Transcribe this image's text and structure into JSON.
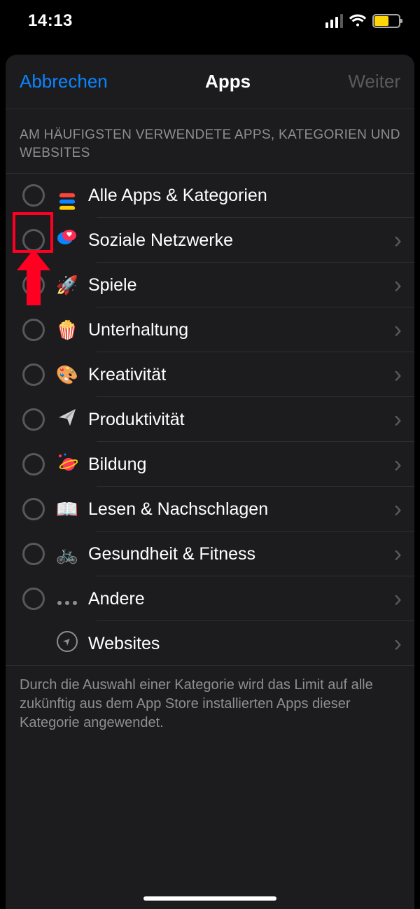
{
  "status": {
    "time": "14:13"
  },
  "nav": {
    "cancel": "Abbrechen",
    "title": "Apps",
    "next": "Weiter"
  },
  "section_header": "AM HÄUFIGSTEN VERWENDETE APPS, KATEGORIEN UND WEBSITES",
  "rows": {
    "all": "Alle Apps & Kategorien",
    "social": "Soziale Netzwerke",
    "games": "Spiele",
    "entertainment": "Unterhaltung",
    "creativity": "Kreativität",
    "productivity": "Produktivität",
    "education": "Bildung",
    "reading": "Lesen & Nachschlagen",
    "health": "Gesundheit & Fitness",
    "other": "Andere",
    "websites": "Websites"
  },
  "footer": "Durch die Auswahl einer Kategorie wird das Limit auf alle zukünftig aus dem App Store installierten Apps dieser Kategorie angewendet.",
  "highlight": {
    "target_row": "social"
  },
  "icons": {
    "social": "💬",
    "games": "🚀",
    "entertainment": "🍿",
    "creativity": "🎨",
    "productivity_alt": "paperplane",
    "education": "🪐",
    "reading": "📖",
    "health": "🚲"
  }
}
